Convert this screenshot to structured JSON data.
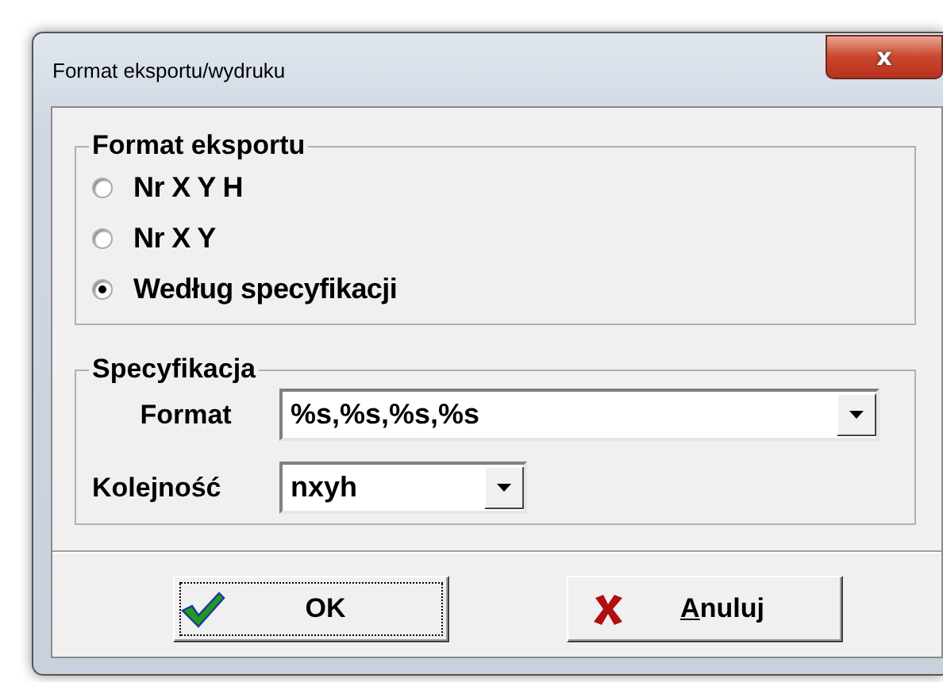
{
  "window": {
    "title": "Format eksportu/wydruku",
    "close_label": "x"
  },
  "export_format": {
    "legend": "Format eksportu",
    "options": [
      {
        "label": "Nr X Y H",
        "selected": false
      },
      {
        "label": "Nr X Y",
        "selected": false
      },
      {
        "label": "Według specyfikacji",
        "selected": true
      }
    ]
  },
  "specification": {
    "legend": "Specyfikacja",
    "fields": [
      {
        "label": "Format",
        "value": "%s,%s,%s,%s",
        "kind": "wide"
      },
      {
        "label": "Kolejność",
        "value": "nxyh",
        "kind": "narrow"
      }
    ]
  },
  "buttons": [
    {
      "label": "OK",
      "kind": "ok",
      "focused": true,
      "first_letter_underlined": false
    },
    {
      "label": "Anuluj",
      "kind": "cancel",
      "focused": false,
      "first_letter_underlined": true
    }
  ]
}
